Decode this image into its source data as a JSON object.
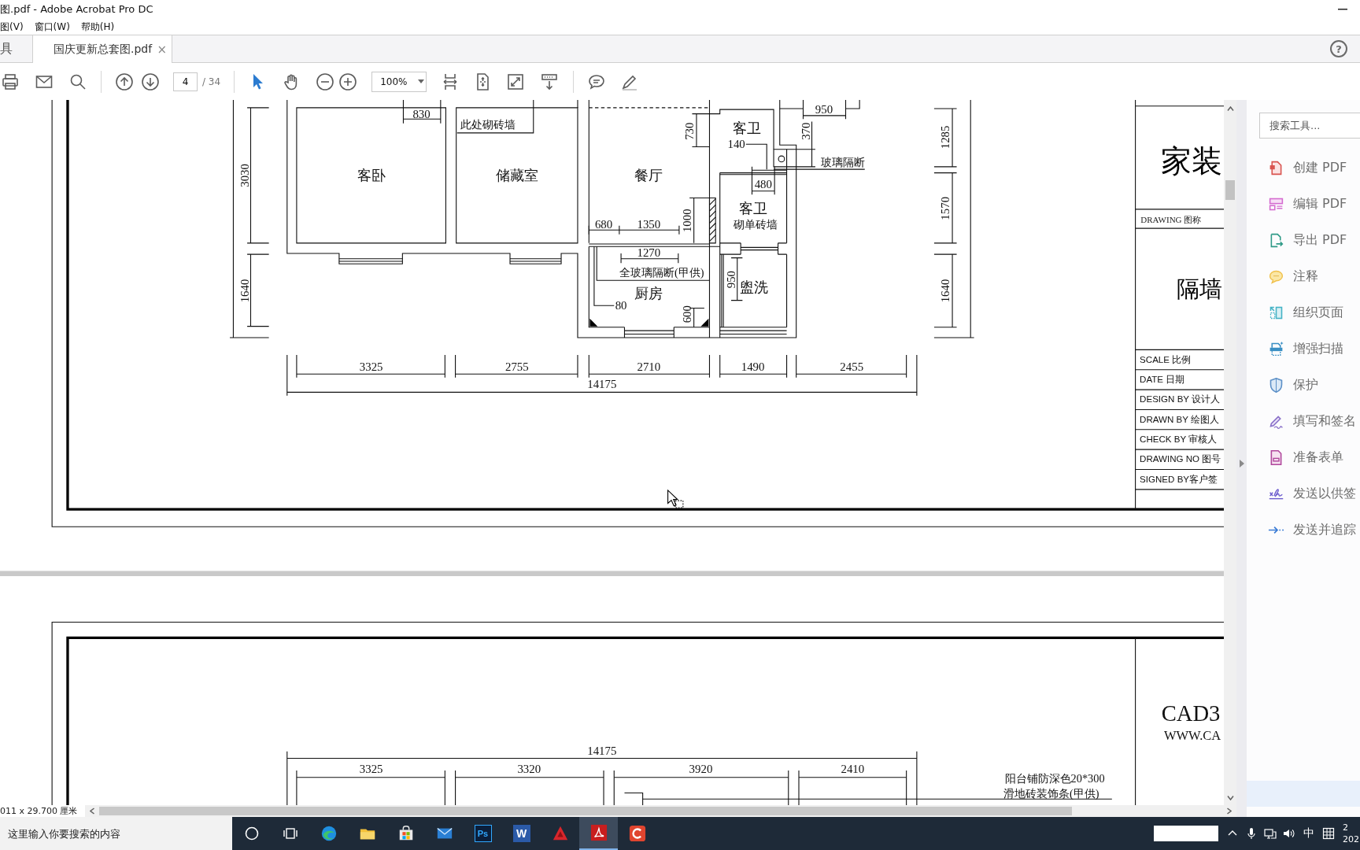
{
  "window": {
    "title": "图.pdf - Adobe Acrobat Pro DC"
  },
  "menu": [
    "图(V)",
    "窗口(W)",
    "帮助(H)"
  ],
  "tab_bar": {
    "tools_label": "具",
    "tabs": [
      {
        "label": "国庆更新总套图.pdf",
        "close": "×",
        "selected": true
      }
    ],
    "help": "?"
  },
  "toolbar": {
    "page": "4",
    "page_count": "/ 34",
    "zoom": "100%"
  },
  "sheet_1": {
    "plan_labels": [
      "830",
      "950",
      "此处砌砖墙",
      "730",
      "客卫",
      "370",
      "1285",
      "140",
      "玻璃隔断",
      "3030",
      "客卧",
      "储藏室",
      "餐厅",
      "480",
      "客卫",
      "1570",
      "680",
      "1350",
      "1000",
      "砌单砖墙",
      "1270",
      "全玻璃隔断(甲供)",
      "1640",
      "厨房",
      "950",
      "盥洗",
      "1640",
      "80",
      "600",
      "3325",
      "2755",
      "2710",
      "1490",
      "2455",
      "14175"
    ],
    "title_block": {
      "project": "家装",
      "drawing_label": "DRAWING 图称",
      "drawing_name": "隔墙",
      "fields": [
        "SCALE 比例",
        "DATE 日期",
        "DESIGN BY 设计人",
        "DRAWN BY 绘图人",
        "CHECK BY 审核人",
        "DRAWING NO 图号",
        "SIGNED BY客户签"
      ]
    }
  },
  "sheet_2": {
    "plan_labels": [
      "14175",
      "3325",
      "3320",
      "3920",
      "2410",
      "阳台铺防深色20*300",
      "滑地砖装饰条(甲供)"
    ],
    "title_block": {
      "logo": "CAD3",
      "website": "WWW.CA"
    }
  },
  "status_bar": {
    "page_size": "011 x 29.700 厘米"
  },
  "tools_panel": {
    "search": {
      "placeholder": "搜索工具..."
    },
    "tools": [
      "创建 PDF",
      "编辑 PDF",
      "导出 PDF",
      "注释",
      "组织页面",
      "增强扫描",
      "保护",
      "填写和签名",
      "准备表单",
      "发送以供签",
      "发送并追踪"
    ]
  },
  "taskbar": {
    "search": {
      "placeholder": "这里输入你要搜索的内容"
    },
    "apps": [
      {
        "selected": false
      },
      {
        "selected": false
      },
      {
        "selected": false
      },
      {
        "selected": false
      },
      {
        "label": "Ps",
        "selected": false
      },
      {
        "label": "W",
        "selected": false
      },
      {
        "selected": false
      },
      {
        "selected": true
      },
      {
        "selected": false
      }
    ],
    "ime": "中",
    "clock": {
      "time": "2",
      "date": "202"
    }
  }
}
